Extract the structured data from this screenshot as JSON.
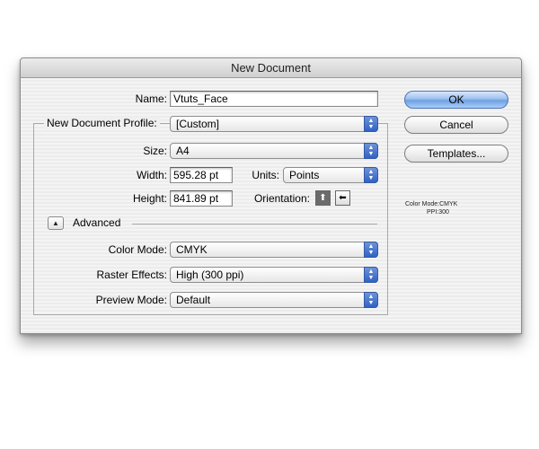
{
  "dialog": {
    "title": "New Document",
    "name_label": "Name:",
    "name_value": "Vtuts_Face",
    "profile_label": "New Document Profile:",
    "profile_value": "[Custom]",
    "size_label": "Size:",
    "size_value": "A4",
    "width_label": "Width:",
    "width_value": "595.28 pt",
    "units_label": "Units:",
    "units_value": "Points",
    "height_label": "Height:",
    "height_value": "841.89 pt",
    "orientation_label": "Orientation:",
    "advanced_label": "Advanced",
    "color_mode_label": "Color Mode:",
    "color_mode_value": "CMYK",
    "raster_label": "Raster Effects:",
    "raster_value": "High (300 ppi)",
    "preview_label": "Preview Mode:",
    "preview_value": "Default",
    "buttons": {
      "ok": "OK",
      "cancel": "Cancel",
      "templates": "Templates..."
    },
    "info": {
      "color_mode": "Color Mode:CMYK",
      "ppi": "PPI:300"
    }
  },
  "icons": {
    "stepper": "up-down-arrows-icon",
    "disclosure": "triangle-up-icon",
    "portrait": "portrait-orientation-icon",
    "landscape": "landscape-orientation-icon"
  },
  "colors": {
    "accent": "#2f62c4",
    "default_button": "#9cc0ee"
  }
}
